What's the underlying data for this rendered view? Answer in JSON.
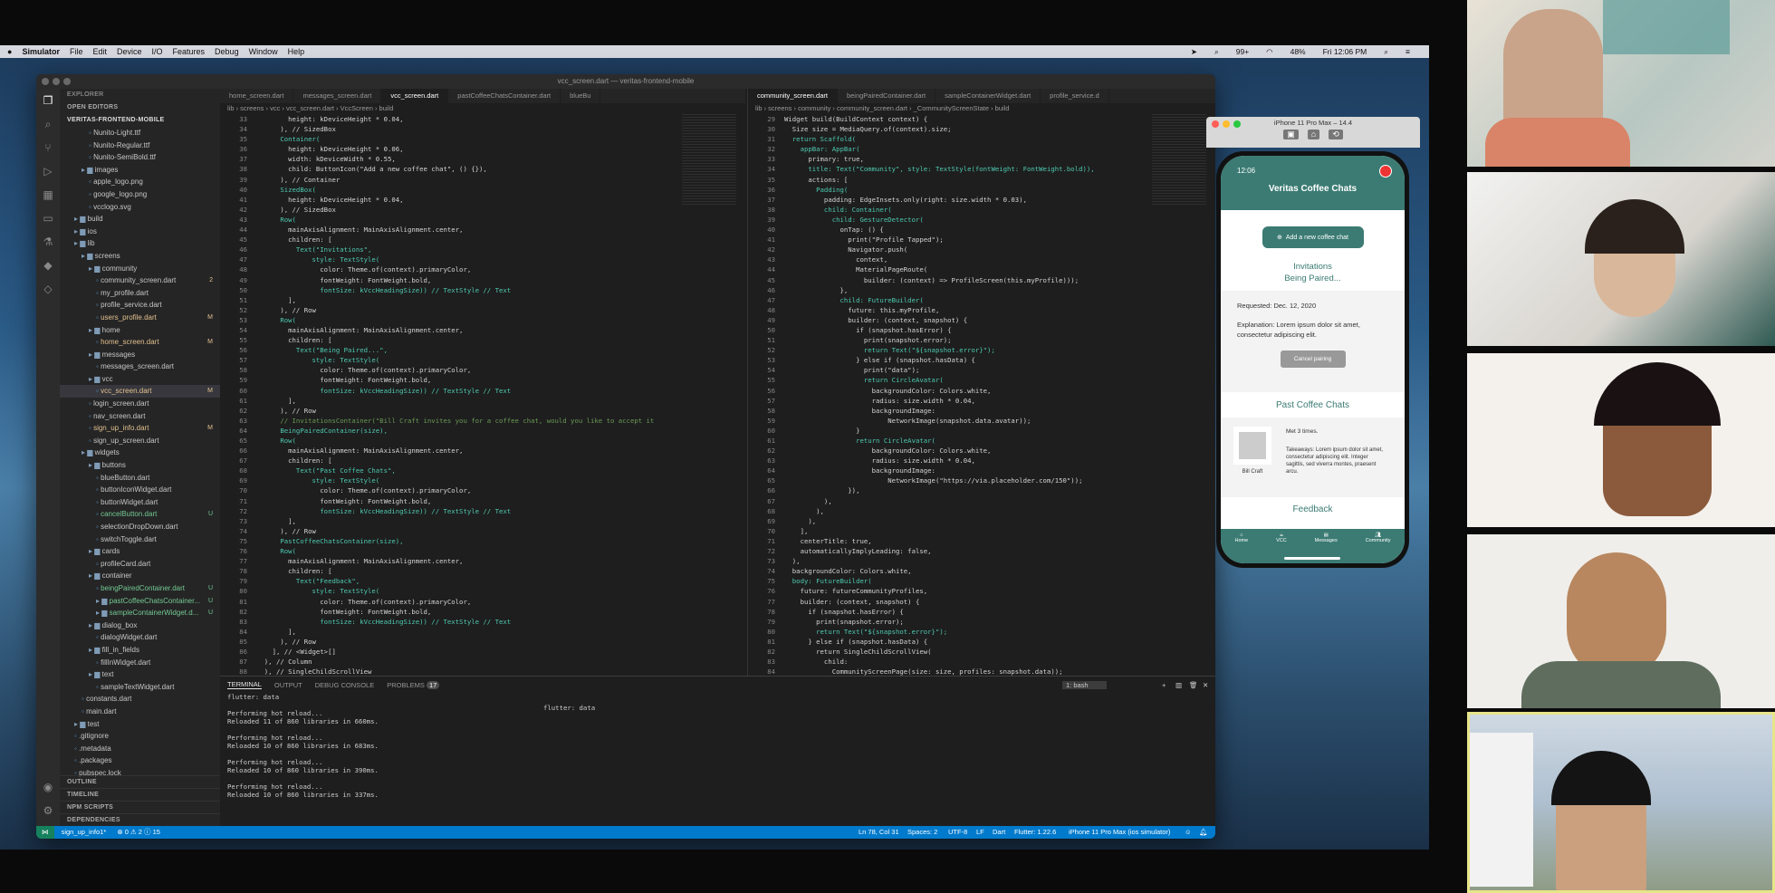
{
  "menubar": {
    "app": "Simulator",
    "items": [
      "File",
      "Edit",
      "Device",
      "I/O",
      "Features",
      "Debug",
      "Window",
      "Help"
    ],
    "right": [
      "99+",
      "48%",
      "Fri 12:06 PM"
    ]
  },
  "vscode": {
    "title": "vcc_screen.dart — veritas-frontend-mobile",
    "explorer_label": "EXPLORER",
    "open_editors": "OPEN EDITORS",
    "project": "VERITAS-FRONTEND-MOBILE",
    "tree": [
      {
        "label": "Nunito-Light.ttf",
        "indent": 4,
        "badge": ""
      },
      {
        "label": "Nunito-Regular.ttf",
        "indent": 4,
        "badge": ""
      },
      {
        "label": "Nunito-SemiBold.ttf",
        "indent": 4,
        "badge": ""
      },
      {
        "label": "images",
        "indent": 3,
        "badge": ""
      },
      {
        "label": "apple_logo.png",
        "indent": 4,
        "badge": ""
      },
      {
        "label": "google_logo.png",
        "indent": 4,
        "badge": ""
      },
      {
        "label": "vcclogo.svg",
        "indent": 4,
        "badge": ""
      },
      {
        "label": "build",
        "indent": 2,
        "badge": ""
      },
      {
        "label": "ios",
        "indent": 2,
        "badge": ""
      },
      {
        "label": "lib",
        "indent": 2,
        "badge": ""
      },
      {
        "label": "screens",
        "indent": 3,
        "badge": ""
      },
      {
        "label": "community",
        "indent": 4,
        "badge": ""
      },
      {
        "label": "community_screen.dart",
        "indent": 5,
        "badge": "2"
      },
      {
        "label": "my_profile.dart",
        "indent": 5,
        "badge": ""
      },
      {
        "label": "profile_service.dart",
        "indent": 5,
        "badge": ""
      },
      {
        "label": "users_profile.dart",
        "indent": 5,
        "badge": "M"
      },
      {
        "label": "home",
        "indent": 4,
        "badge": ""
      },
      {
        "label": "home_screen.dart",
        "indent": 5,
        "badge": "M"
      },
      {
        "label": "messages",
        "indent": 4,
        "badge": ""
      },
      {
        "label": "messages_screen.dart",
        "indent": 5,
        "badge": ""
      },
      {
        "label": "vcc",
        "indent": 4,
        "badge": ""
      },
      {
        "label": "vcc_screen.dart",
        "indent": 5,
        "badge": "M"
      },
      {
        "label": "login_screen.dart",
        "indent": 4,
        "badge": ""
      },
      {
        "label": "nav_screen.dart",
        "indent": 4,
        "badge": ""
      },
      {
        "label": "sign_up_info.dart",
        "indent": 4,
        "badge": "M"
      },
      {
        "label": "sign_up_screen.dart",
        "indent": 4,
        "badge": ""
      },
      {
        "label": "widgets",
        "indent": 3,
        "badge": ""
      },
      {
        "label": "buttons",
        "indent": 4,
        "badge": ""
      },
      {
        "label": "blueButton.dart",
        "indent": 5,
        "badge": ""
      },
      {
        "label": "buttonIconWidget.dart",
        "indent": 5,
        "badge": ""
      },
      {
        "label": "buttonWidget.dart",
        "indent": 5,
        "badge": ""
      },
      {
        "label": "cancelButton.dart",
        "indent": 5,
        "badge": "U"
      },
      {
        "label": "selectionDropDown.dart",
        "indent": 5,
        "badge": ""
      },
      {
        "label": "switchToggle.dart",
        "indent": 5,
        "badge": ""
      },
      {
        "label": "cards",
        "indent": 4,
        "badge": ""
      },
      {
        "label": "profileCard.dart",
        "indent": 5,
        "badge": ""
      },
      {
        "label": "container",
        "indent": 4,
        "badge": ""
      },
      {
        "label": "beingPairedContainer.dart",
        "indent": 5,
        "badge": "U"
      },
      {
        "label": "pastCoffeeChatsContainer...",
        "indent": 5,
        "badge": "U"
      },
      {
        "label": "sampleContainerWidget.d...",
        "indent": 5,
        "badge": "U"
      },
      {
        "label": "dialog_box",
        "indent": 4,
        "badge": ""
      },
      {
        "label": "dialogWidget.dart",
        "indent": 5,
        "badge": ""
      },
      {
        "label": "fill_in_fields",
        "indent": 4,
        "badge": ""
      },
      {
        "label": "fillInWidget.dart",
        "indent": 5,
        "badge": ""
      },
      {
        "label": "text",
        "indent": 4,
        "badge": ""
      },
      {
        "label": "sampleTextWidget.dart",
        "indent": 5,
        "badge": ""
      },
      {
        "label": "constants.dart",
        "indent": 3,
        "badge": ""
      },
      {
        "label": "main.dart",
        "indent": 3,
        "badge": ""
      },
      {
        "label": "test",
        "indent": 2,
        "badge": ""
      },
      {
        "label": ".gitignore",
        "indent": 2,
        "badge": ""
      },
      {
        "label": ".metadata",
        "indent": 2,
        "badge": ""
      },
      {
        "label": ".packages",
        "indent": 2,
        "badge": ""
      },
      {
        "label": "pubspec.lock",
        "indent": 2,
        "badge": ""
      }
    ],
    "sections": [
      "OUTLINE",
      "TIMELINE",
      "NPM SCRIPTS",
      "DEPENDENCIES"
    ],
    "left_tabs": [
      "home_screen.dart",
      "messages_screen.dart",
      "vcc_screen.dart",
      "pastCoffeeChatsContainer.dart",
      "blueBu"
    ],
    "left_crumb": "lib › screens › vcc › vcc_screen.dart › VccScreen › build",
    "left_code": [
      [
        "33",
        "        height: kDeviceHeight * 0.04,"
      ],
      [
        "34",
        "      ), // SizedBox"
      ],
      [
        "35",
        "      Container("
      ],
      [
        "36",
        "        height: kDeviceHeight * 0.06,"
      ],
      [
        "37",
        "        width: kDeviceWidth * 0.55,"
      ],
      [
        "38",
        "        child: ButtonIcon(\"Add a new coffee chat\", () {}),"
      ],
      [
        "39",
        "      ), // Container"
      ],
      [
        "40",
        "      SizedBox("
      ],
      [
        "41",
        "        height: kDeviceHeight * 0.04,"
      ],
      [
        "42",
        "      ), // SizedBox"
      ],
      [
        "43",
        "      Row("
      ],
      [
        "44",
        "        mainAxisAlignment: MainAxisAlignment.center,"
      ],
      [
        "45",
        "        children: ["
      ],
      [
        "46",
        "          Text(\"Invitations\","
      ],
      [
        "47",
        "              style: TextStyle("
      ],
      [
        "48",
        "                color: Theme.of(context).primaryColor,"
      ],
      [
        "49",
        "                fontWeight: FontWeight.bold,"
      ],
      [
        "50",
        "                fontSize: kVccHeadingSize)) // TextStyle // Text"
      ],
      [
        "51",
        "        ],"
      ],
      [
        "52",
        "      ), // Row"
      ],
      [
        "53",
        "      Row("
      ],
      [
        "54",
        "        mainAxisAlignment: MainAxisAlignment.center,"
      ],
      [
        "55",
        "        children: ["
      ],
      [
        "56",
        "          Text(\"Being Paired...\","
      ],
      [
        "57",
        "              style: TextStyle("
      ],
      [
        "58",
        "                color: Theme.of(context).primaryColor,"
      ],
      [
        "59",
        "                fontWeight: FontWeight.bold,"
      ],
      [
        "60",
        "                fontSize: kVccHeadingSize)) // TextStyle // Text"
      ],
      [
        "61",
        "        ],"
      ],
      [
        "62",
        "      ), // Row"
      ],
      [
        "63",
        "      // InvitationsContainer(\"Bill Craft invites you for a coffee chat, would you like to accept it"
      ],
      [
        "64",
        "      BeingPairedContainer(size),"
      ],
      [
        "65",
        "      Row("
      ],
      [
        "66",
        "        mainAxisAlignment: MainAxisAlignment.center,"
      ],
      [
        "67",
        "        children: ["
      ],
      [
        "68",
        "          Text(\"Past Coffee Chats\","
      ],
      [
        "69",
        "              style: TextStyle("
      ],
      [
        "70",
        "                color: Theme.of(context).primaryColor,"
      ],
      [
        "71",
        "                fontWeight: FontWeight.bold,"
      ],
      [
        "72",
        "                fontSize: kVccHeadingSize)) // TextStyle // Text"
      ],
      [
        "73",
        "        ],"
      ],
      [
        "74",
        "      ), // Row"
      ],
      [
        "75",
        "      PastCoffeeChatsContainer(size),"
      ],
      [
        "76",
        "      Row("
      ],
      [
        "77",
        "        mainAxisAlignment: MainAxisAlignment.center,"
      ],
      [
        "78",
        "        children: ["
      ],
      [
        "79",
        "          Text(\"Feedback\","
      ],
      [
        "80",
        "              style: TextStyle("
      ],
      [
        "81",
        "                color: Theme.of(context).primaryColor,"
      ],
      [
        "82",
        "                fontWeight: FontWeight.bold,"
      ],
      [
        "83",
        "                fontSize: kVccHeadingSize)) // TextStyle // Text"
      ],
      [
        "84",
        "        ],"
      ],
      [
        "85",
        "      ), // Row"
      ],
      [
        "86",
        "    ], // <Widget>[]"
      ],
      [
        "87",
        "  ), // Column"
      ],
      [
        "88",
        "  ), // SingleChildScrollView"
      ],
      [
        "89",
        "  bottomNavigationBar: NavScreen(),"
      ]
    ],
    "right_tabs": [
      "community_screen.dart",
      "beingPairedContainer.dart",
      "sampleContainerWidget.dart",
      "profile_service.d"
    ],
    "right_crumb": "lib › screens › community › community_screen.dart › _CommunityScreenState › build",
    "right_code": [
      [
        "29",
        "Widget build(BuildContext context) {"
      ],
      [
        "30",
        "  Size size = MediaQuery.of(context).size;"
      ],
      [
        "31",
        "  return Scaffold("
      ],
      [
        "32",
        "    appBar: AppBar("
      ],
      [
        "33",
        "      primary: true,"
      ],
      [
        "34",
        "      title: Text(\"Community\", style: TextStyle(fontWeight: FontWeight.bold)),"
      ],
      [
        "35",
        "      actions: ["
      ],
      [
        "36",
        "        Padding("
      ],
      [
        "37",
        "          padding: EdgeInsets.only(right: size.width * 0.03),"
      ],
      [
        "38",
        "          child: Container("
      ],
      [
        "39",
        "            child: GestureDetector("
      ],
      [
        "40",
        "              onTap: () {"
      ],
      [
        "41",
        "                print(\"Profile Tapped\");"
      ],
      [
        "42",
        "                Navigator.push("
      ],
      [
        "43",
        "                  context,"
      ],
      [
        "44",
        "                  MaterialPageRoute("
      ],
      [
        "45",
        "                    builder: (context) => ProfileScreen(this.myProfile)));"
      ],
      [
        "46",
        "              },"
      ],
      [
        "47",
        "              child: FutureBuilder("
      ],
      [
        "48",
        "                future: this.myProfile,"
      ],
      [
        "49",
        "                builder: (context, snapshot) {"
      ],
      [
        "50",
        "                  if (snapshot.hasError) {"
      ],
      [
        "51",
        "                    print(snapshot.error);"
      ],
      [
        "52",
        "                    return Text(\"${snapshot.error}\");"
      ],
      [
        "53",
        "                  } else if (snapshot.hasData) {"
      ],
      [
        "54",
        "                    print(\"data\");"
      ],
      [
        "55",
        "                    return CircleAvatar("
      ],
      [
        "56",
        "                      backgroundColor: Colors.white,"
      ],
      [
        "57",
        "                      radius: size.width * 0.04,"
      ],
      [
        "58",
        "                      backgroundImage:"
      ],
      [
        "59",
        "                          NetworkImage(snapshot.data.avatar));"
      ],
      [
        "60",
        "                  }"
      ],
      [
        "61",
        "                  return CircleAvatar("
      ],
      [
        "62",
        "                      backgroundColor: Colors.white,"
      ],
      [
        "63",
        "                      radius: size.width * 0.04,"
      ],
      [
        "64",
        "                      backgroundImage:"
      ],
      [
        "65",
        "                          NetworkImage(\"https://via.placeholder.com/150\"));"
      ],
      [
        "66",
        "                }),"
      ],
      [
        "67",
        "          ),"
      ],
      [
        "68",
        "        ),"
      ],
      [
        "69",
        "      ),"
      ],
      [
        "70",
        "    ],"
      ],
      [
        "71",
        "    centerTitle: true,"
      ],
      [
        "72",
        "    automaticallyImplyLeading: false,"
      ],
      [
        "73",
        "  ),"
      ],
      [
        "74",
        "  backgroundColor: Colors.white,"
      ],
      [
        "75",
        "  body: FutureBuilder("
      ],
      [
        "76",
        "    future: futureCommunityProfiles,"
      ],
      [
        "77",
        "    builder: (context, snapshot) {"
      ],
      [
        "78",
        "      if (snapshot.hasError) {"
      ],
      [
        "79",
        "        print(snapshot.error);"
      ],
      [
        "80",
        "        return Text(\"${snapshot.error}\");"
      ],
      [
        "81",
        "      } else if (snapshot.hasData) {"
      ],
      [
        "82",
        "        return SingleChildScrollView("
      ],
      [
        "83",
        "          child:"
      ],
      [
        "84",
        "            CommunityScreenPage(size: size, profiles: snapshot.data));"
      ]
    ],
    "panel_tabs": [
      "TERMINAL",
      "OUTPUT",
      "DEBUG CONSOLE",
      "PROBLEMS"
    ],
    "problems_count": "17",
    "terminal_select": "1: bash",
    "terminal_lines": [
      "flutter: data",
      "",
      "Performing hot reload...",
      "Reloaded 11 of 860 libraries in 660ms.",
      "",
      "Performing hot reload...",
      "Reloaded 10 of 860 libraries in 683ms.",
      "",
      "Performing hot reload...",
      "Reloaded 10 of 860 libraries in 390ms.",
      "",
      "Performing hot reload...",
      "Reloaded 10 of 860 libraries in 337ms."
    ],
    "terminal_side": "flutter: data",
    "status_left": [
      "sign_up_info1*",
      "⊗ 0 ⚠ 2 ⓘ 15"
    ],
    "status_right": [
      "Ln 78, Col 31",
      "Spaces: 2",
      "UTF-8",
      "LF",
      "Dart",
      "Flutter: 1.22.6",
      "iPhone 11 Pro Max (ios simulator)"
    ]
  },
  "simulator": {
    "title": "iPhone 11 Pro Max – 14.4",
    "time": "12:06",
    "app_title": "Veritas Coffee Chats",
    "add_button": "Add a new coffee chat",
    "invitations": "Invitations",
    "being_paired": "Being Paired...",
    "requested": "Requested: Dec. 12, 2020",
    "explanation": "Explanation: Lorem ipsum dolor sit amet, consectetur adipiscing elit.",
    "cancel": "Cancel pairing",
    "past_title": "Past Coffee Chats",
    "met": "Met 3 times.",
    "takeaways": "Takeaways: Lorem ipsum dolor sit amet, consectetur adipiscing elit. Integer sagittis, sed viverra montes, praesent arcu.",
    "person": "Bill Craft",
    "feedback": "Feedback",
    "nav": [
      "Home",
      "VCC",
      "Messages",
      "Community"
    ],
    "accent": "#3b7b73"
  },
  "participants": [
    "participant-1",
    "participant-2",
    "participant-3",
    "participant-4",
    "participant-5"
  ]
}
